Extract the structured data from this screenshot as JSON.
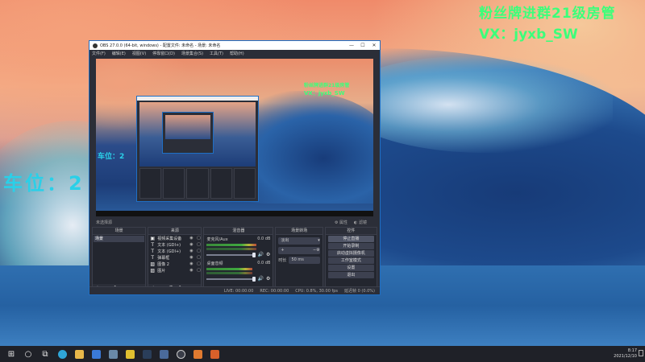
{
  "overlay": {
    "fans_text": "粉丝牌进群21级房管",
    "vx_text": "VX：jyxb_SW",
    "seat_text": "车位：2"
  },
  "window": {
    "title": "OBS 27.0.0 (64-bit, windows) - 配置文件: 未命名 - 场景: 未命名",
    "minimize": "—",
    "maximize": "☐",
    "close": "✕"
  },
  "menu": [
    "文件(F)",
    "编辑(E)",
    "视图(V)",
    "停靠窗口(D)",
    "场景集合(S)",
    "工具(T)",
    "帮助(H)"
  ],
  "preview": {
    "fans_text": "粉丝牌进群21级房管",
    "vx_text": "VX：jyxb_SW",
    "seat_text": "车位：2"
  },
  "scene_bar": {
    "label": "未选择源",
    "props": "属性",
    "filters": "滤镜"
  },
  "docks": {
    "scenes": {
      "header": "场景",
      "items": [
        "场景"
      ]
    },
    "sources": {
      "header": "来源",
      "items": [
        {
          "icon": "camera-icon",
          "glyph": "▣",
          "name": "视频采集设备"
        },
        {
          "icon": "text-icon",
          "glyph": "T",
          "name": "文本 (GDI+)"
        },
        {
          "icon": "text-icon",
          "glyph": "T",
          "name": "文本 (GDI+)"
        },
        {
          "icon": "text-icon",
          "glyph": "T",
          "name": "弹幕框"
        },
        {
          "icon": "image-icon",
          "glyph": "▨",
          "name": "图像 2"
        },
        {
          "icon": "image-icon",
          "glyph": "▨",
          "name": "图片"
        }
      ]
    },
    "mixer": {
      "header": "混音器",
      "channels": [
        {
          "name": "麦克风/Aux",
          "db": "0.0 dB",
          "level": 0.78
        },
        {
          "name": "桌面音频",
          "db": "0.0 dB",
          "level": 0.72
        }
      ]
    },
    "transitions": {
      "header": "场景转场",
      "type": "淡出",
      "duration_label": "时长",
      "duration": "50 ms"
    },
    "controls": {
      "header": "控件",
      "buttons": [
        "停止直播",
        "开始录制",
        "启动虚拟摄像机",
        "工作室模式",
        "设置",
        "退出"
      ]
    }
  },
  "statusbar": {
    "live": "LIVE: 00:00:00",
    "rec": "REC: 00:00:00",
    "cpu": "CPU: 0.8%, 30.00 fps",
    "dropped": "延迟帧 0 (0.0%)"
  },
  "taskbar": {
    "time": "8:17",
    "date": "2021/12/10"
  }
}
